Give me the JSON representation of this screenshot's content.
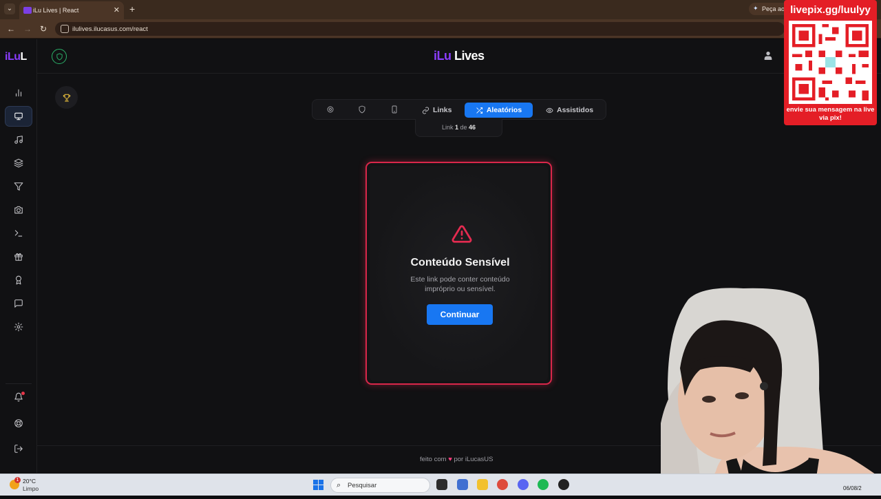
{
  "browser": {
    "tab_title": "iLu Lives | React",
    "ask_label": "Peça ao",
    "url": "ilulives.ilucasus.com/react"
  },
  "brand": {
    "part1": "iLu",
    "part2": "Lives",
    "side_part1": "iLu",
    "side_part2": "L"
  },
  "sidebar": {
    "items": [
      {
        "icon": "bar-chart-icon"
      },
      {
        "icon": "monitor-icon",
        "active": true
      },
      {
        "icon": "music-icon"
      },
      {
        "icon": "layers-icon"
      },
      {
        "icon": "filter-icon"
      },
      {
        "icon": "camera-icon"
      },
      {
        "icon": "terminal-icon"
      },
      {
        "icon": "gift-icon"
      },
      {
        "icon": "award-icon"
      },
      {
        "icon": "message-icon"
      },
      {
        "icon": "settings-icon"
      }
    ],
    "bottom": [
      {
        "icon": "bell-icon"
      },
      {
        "icon": "lifebuoy-icon"
      },
      {
        "icon": "logout-icon"
      }
    ]
  },
  "toolbar": {
    "tabs": [
      {
        "label": "Links",
        "icon": "link-icon"
      },
      {
        "label": "Aleatórios",
        "icon": "shuffle-icon",
        "active": true
      },
      {
        "label": "Assistidos",
        "icon": "eye-icon"
      }
    ],
    "icon_buttons": [
      "settings-icon",
      "shield-icon",
      "tablet-icon"
    ]
  },
  "counter": {
    "prefix": "Link",
    "current": "1",
    "middle": "de",
    "total": "46"
  },
  "card": {
    "title": "Conteúdo Sensível",
    "description": "Este link pode conter conteúdo impróprio ou sensível.",
    "button": "Continuar"
  },
  "footer": {
    "before": "feito com",
    "after": "por iLucasUS"
  },
  "overlay": {
    "title": "livepix.gg/luulyy",
    "caption": "envie sua mensagem na live via pix!"
  },
  "taskbar": {
    "temp": "20°C",
    "weather": "Limpo",
    "weather_badge": "1",
    "search_placeholder": "Pesquisar",
    "date": "06/08/2"
  },
  "colors": {
    "accent": "#1877f2",
    "brand_purple": "#8b3dff",
    "danger": "#d9274a",
    "qr_red": "#e41e26"
  }
}
